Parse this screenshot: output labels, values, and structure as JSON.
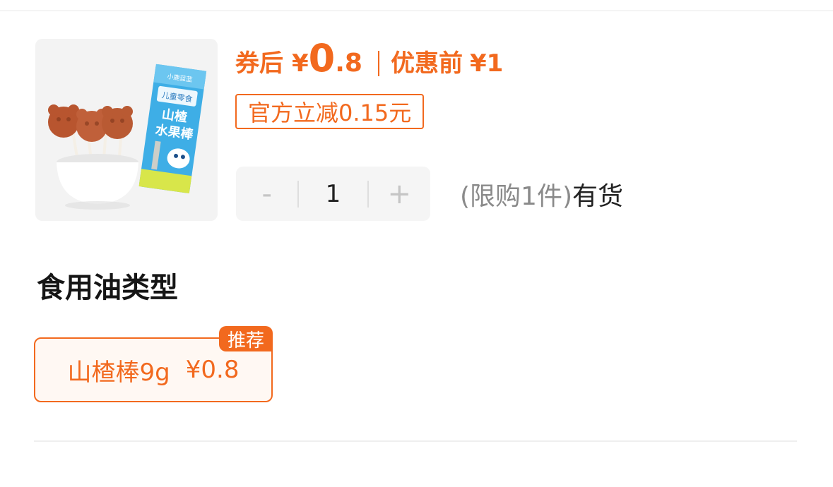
{
  "price": {
    "coupon_label": "券后",
    "yen": "¥",
    "integer": "0",
    "decimal": ".8",
    "original_label": "优惠前",
    "original_price": "¥1"
  },
  "discount_tag": "官方立减0.15元",
  "stepper": {
    "minus": "-",
    "quantity": "1",
    "plus": "+"
  },
  "stock": {
    "limit": "(限购1件)",
    "status": "有货"
  },
  "section_title": "食用油类型",
  "option": {
    "name": "山楂棒9g",
    "price": "¥0.8",
    "badge": "推荐"
  },
  "product_image": {
    "pack_title_line1": "山楂",
    "pack_title_line2": "水果棒",
    "pack_top_text": "小鹿蓝蓝",
    "pack_sub_text": "儿童零食"
  },
  "colors": {
    "accent": "#f2691e",
    "thumb_bg": "#f3f3f3",
    "stepper_bg": "#f5f5f5"
  }
}
